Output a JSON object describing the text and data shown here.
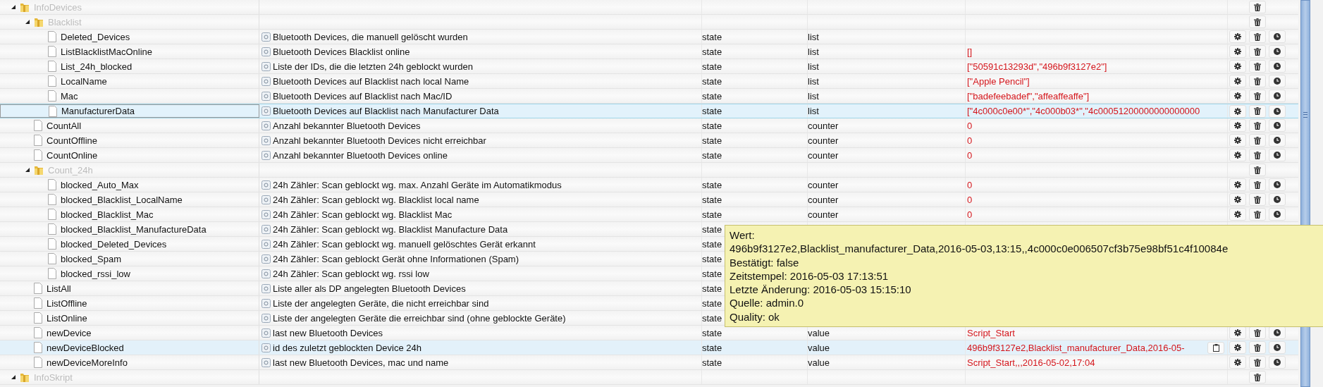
{
  "tree": [
    {
      "name": "InfoDevices",
      "kind": "folder",
      "expanded": true,
      "selected": false,
      "actions": [
        {
          "kind": "delete"
        }
      ],
      "children": [
        {
          "name": "Blacklist",
          "kind": "folder",
          "expanded": true,
          "selected": false,
          "actions": [
            {
              "kind": "delete"
            }
          ],
          "children": [
            {
              "name": "Deleted_Devices",
              "kind": "state",
              "selected": false,
              "description": "Bluetooth Devices, die manuell gelöscht wurden",
              "type": "state",
              "role": "list",
              "actions": [
                {
                  "kind": "settings"
                },
                {
                  "kind": "delete"
                },
                {
                  "kind": "history"
                }
              ]
            },
            {
              "name": "ListBlacklistMacOnline",
              "kind": "state",
              "selected": false,
              "description": "Bluetooth Devices Blacklist online",
              "type": "state",
              "role": "list",
              "value": "[]",
              "actions": [
                {
                  "kind": "settings"
                },
                {
                  "kind": "delete"
                },
                {
                  "kind": "history"
                }
              ]
            },
            {
              "name": "List_24h_blocked",
              "kind": "state",
              "selected": false,
              "description": "Liste der IDs, die die letzten 24h geblockt wurden",
              "type": "state",
              "role": "list",
              "value": "[\"50591c13293d\",\"496b9f3127e2\"]",
              "actions": [
                {
                  "kind": "settings"
                },
                {
                  "kind": "delete"
                },
                {
                  "kind": "history"
                }
              ]
            },
            {
              "name": "LocalName",
              "kind": "state",
              "selected": false,
              "description": "Bluetooth Devices auf Blacklist nach local Name",
              "type": "state",
              "role": "list",
              "value": "[\"Apple Pencil\"]",
              "actions": [
                {
                  "kind": "settings"
                },
                {
                  "kind": "delete"
                },
                {
                  "kind": "history"
                }
              ]
            },
            {
              "name": "Mac",
              "kind": "state",
              "selected": false,
              "description": "Bluetooth Devices auf Blacklist nach Mac/ID",
              "type": "state",
              "role": "list",
              "value": "[\"badefeebadef\",\"affeaffeaffe\"]",
              "actions": [
                {
                  "kind": "settings"
                },
                {
                  "kind": "delete"
                },
                {
                  "kind": "history"
                }
              ]
            },
            {
              "name": "ManufacturerData",
              "kind": "state",
              "selected": true,
              "description": "Bluetooth Devices auf Blacklist nach Manufacturer Data",
              "type": "state",
              "role": "list",
              "value": "[\"4c000c0e00*\",\"4c000b03*\",\"4c00051200000000000000",
              "actions": [
                {
                  "kind": "settings"
                },
                {
                  "kind": "delete"
                },
                {
                  "kind": "history"
                }
              ]
            }
          ]
        },
        {
          "name": "CountAll",
          "kind": "state",
          "selected": false,
          "description": "Anzahl bekannter Bluetooth Devices",
          "type": "state",
          "role": "counter",
          "value": "0",
          "actions": [
            {
              "kind": "settings"
            },
            {
              "kind": "delete"
            },
            {
              "kind": "history"
            }
          ]
        },
        {
          "name": "CountOffline",
          "kind": "state",
          "selected": false,
          "description": "Anzahl bekannter Bluetooth Devices nicht erreichbar",
          "type": "state",
          "role": "counter",
          "value": "0",
          "actions": [
            {
              "kind": "settings"
            },
            {
              "kind": "delete"
            },
            {
              "kind": "history"
            }
          ]
        },
        {
          "name": "CountOnline",
          "kind": "state",
          "selected": false,
          "description": "Anzahl bekannter Bluetooth Devices online",
          "type": "state",
          "role": "counter",
          "value": "0",
          "actions": [
            {
              "kind": "settings"
            },
            {
              "kind": "delete"
            },
            {
              "kind": "history"
            }
          ]
        },
        {
          "name": "Count_24h",
          "kind": "folder",
          "expanded": true,
          "selected": false,
          "actions": [
            {
              "kind": "delete"
            }
          ],
          "children": [
            {
              "name": "blocked_Auto_Max",
              "kind": "state",
              "selected": false,
              "description": "24h Zähler: Scan geblockt wg. max. Anzahl Geräte im Automatikmodus",
              "type": "state",
              "role": "counter",
              "value": "0",
              "actions": [
                {
                  "kind": "settings"
                },
                {
                  "kind": "delete"
                },
                {
                  "kind": "history"
                }
              ]
            },
            {
              "name": "blocked_Blacklist_LocalName",
              "kind": "state",
              "selected": false,
              "description": "24h Zähler: Scan geblockt wg. Blacklist local name",
              "type": "state",
              "role": "counter",
              "value": "0",
              "actions": [
                {
                  "kind": "settings"
                },
                {
                  "kind": "delete"
                },
                {
                  "kind": "history"
                }
              ]
            },
            {
              "name": "blocked_Blacklist_Mac",
              "kind": "state",
              "selected": false,
              "description": "24h Zähler: Scan geblockt wg. Blacklist Mac",
              "type": "state",
              "role": "counter",
              "value": "0",
              "actions": [
                {
                  "kind": "settings"
                },
                {
                  "kind": "delete"
                },
                {
                  "kind": "history"
                }
              ]
            },
            {
              "name": "blocked_Blacklist_ManufactureData",
              "kind": "state",
              "selected": false,
              "description": "24h Zähler: Scan geblockt wg. Blacklist Manufacture Data",
              "type": "state"
            },
            {
              "name": "blocked_Deleted_Devices",
              "kind": "state",
              "selected": false,
              "description": "24h Zähler: Scan geblockt wg. manuell gelöschtes Gerät erkannt",
              "type": "state"
            },
            {
              "name": "blocked_Spam",
              "kind": "state",
              "selected": false,
              "description": "24h Zähler: Scan geblockt Gerät ohne Informationen (Spam)",
              "type": "state"
            },
            {
              "name": "blocked_rssi_low",
              "kind": "state",
              "selected": false,
              "description": "24h Zähler: Scan geblockt wg. rssi low",
              "type": "state"
            }
          ]
        },
        {
          "name": "ListAll",
          "kind": "state",
          "selected": false,
          "description": "Liste aller als DP angelegten Bluetooth Devices",
          "type": "state"
        },
        {
          "name": "ListOffline",
          "kind": "state",
          "selected": false,
          "description": "Liste der angelegten Geräte, die nicht erreichbar sind",
          "type": "state"
        },
        {
          "name": "ListOnline",
          "kind": "state",
          "selected": false,
          "description": "Liste der angelegten Geräte die erreichbar sind (ohne geblockte Geräte)",
          "type": "state"
        },
        {
          "name": "newDevice",
          "kind": "state",
          "selected": false,
          "description": "last new Bluetooth Devices",
          "type": "state",
          "role": "value",
          "value": "Script_Start",
          "actions": [
            {
              "kind": "settings"
            },
            {
              "kind": "delete"
            },
            {
              "kind": "history"
            }
          ]
        },
        {
          "name": "newDeviceBlocked",
          "kind": "state",
          "selected": false,
          "hovered": true,
          "description": "id des zuletzt geblockten Device 24h",
          "type": "state",
          "role": "value",
          "value": "496b9f3127e2,Blacklist_manufacturer_Data,2016-05-",
          "actions": [
            {
              "kind": "copy"
            },
            {
              "kind": "settings"
            },
            {
              "kind": "delete"
            },
            {
              "kind": "history"
            }
          ]
        },
        {
          "name": "newDeviceMoreInfo",
          "kind": "state",
          "selected": false,
          "description": "last new Bluetooth Devices, mac und name",
          "type": "state",
          "role": "value",
          "value": "Script_Start,,,2016-05-02,17:04",
          "actions": [
            {
              "kind": "settings"
            },
            {
              "kind": "delete"
            },
            {
              "kind": "history"
            }
          ]
        }
      ]
    },
    {
      "name": "InfoSkript",
      "kind": "folder",
      "expanded": true,
      "selected": false,
      "actions": [
        {
          "kind": "delete"
        }
      ]
    }
  ],
  "tooltip": {
    "lines": [
      "Wert:",
      "496b9f3127e2,Blacklist_manufacturer_Data,2016-05-03,13:15,,4c000c0e006507cf3b75e98bf51c4f10084e",
      "Bestätigt: false",
      "Zeitstempel: 2016-05-03 17:13:51",
      "Letzte Änderung: 2016-05-03 15:15:10",
      "Quelle: admin.0",
      "Quality: ok"
    ]
  }
}
